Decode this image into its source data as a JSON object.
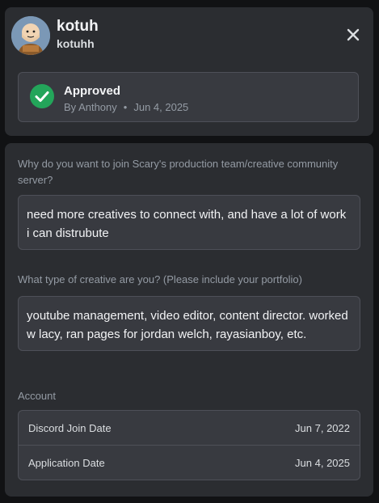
{
  "profile": {
    "display_name": "kotuh",
    "username": "kotuhh"
  },
  "status": {
    "title": "Approved",
    "reviewer": "By Anthony",
    "separator": "•",
    "date": "Jun 4, 2025",
    "color": "#23a55a"
  },
  "questions": [
    {
      "label": "Why do you want to join Scary's production team/creative community server?",
      "answer": "need more creatives to connect with, and have a lot of work i can distrubute"
    },
    {
      "label": "What type of creative are you? (Please include your portfolio)",
      "answer": "youtube management, video editor, content director. worked w lacy, ran pages for jordan welch, rayasianboy, etc."
    }
  ],
  "account": {
    "label": "Account",
    "rows": [
      {
        "label": "Discord Join Date",
        "value": "Jun 7, 2022"
      },
      {
        "label": "Application Date",
        "value": "Jun 4, 2025"
      }
    ]
  },
  "icons": {
    "close": "close-icon",
    "check": "checkmark-icon",
    "avatar": "avatar"
  }
}
